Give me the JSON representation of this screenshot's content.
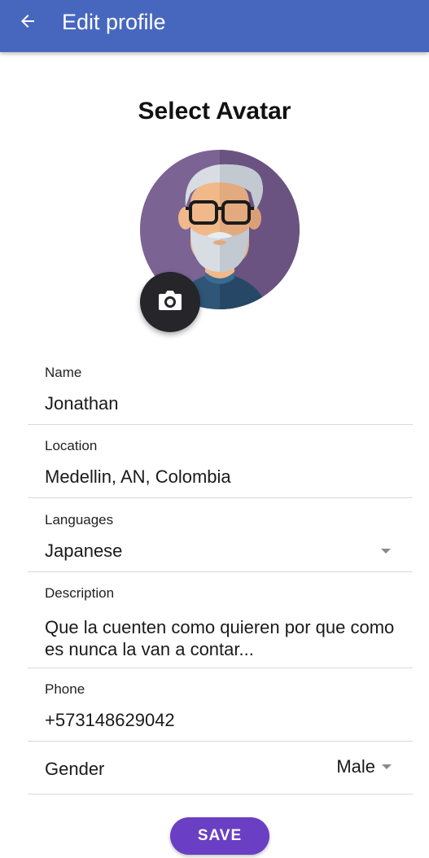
{
  "appbar": {
    "title": "Edit profile",
    "back_icon": "arrow-left-icon",
    "color": "#4767bf"
  },
  "avatar_section": {
    "title": "Select Avatar",
    "camera_icon": "camera-icon"
  },
  "form": {
    "name": {
      "label": "Name",
      "value": "Jonathan"
    },
    "location": {
      "label": "Location",
      "value": "Medellin, AN, Colombia"
    },
    "languages": {
      "label": "Languages",
      "value": "Japanese"
    },
    "description": {
      "label": "Description",
      "value": "Que la cuenten como quieren por que como es nunca la van a contar..."
    },
    "phone": {
      "label": "Phone",
      "value": "+573148629042"
    },
    "gender": {
      "label": "Gender",
      "value": "Male"
    }
  },
  "actions": {
    "save_label": "SAVE",
    "save_color": "#6a3fc4"
  }
}
